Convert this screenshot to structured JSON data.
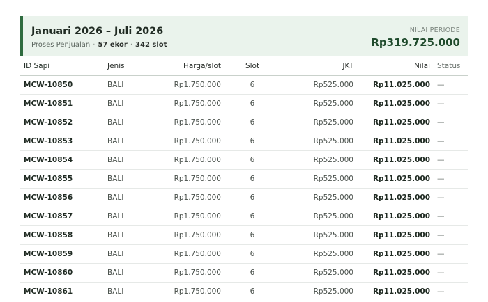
{
  "header": {
    "title": "Januari 2026 – Juli 2026",
    "subtitle_label": "Proses Penjualan",
    "ekor": "57 ekor",
    "slot": "342 slot",
    "separator": "·",
    "value_label": "NILAI PERIODE",
    "value": "Rp319.725.000"
  },
  "table": {
    "columns": {
      "id": "ID Sapi",
      "jenis": "Jenis",
      "harga": "Harga/slot",
      "slot": "Slot",
      "jkt": "JKT",
      "nilai": "Nilai",
      "status": "Status"
    },
    "rows": [
      {
        "id": "MCW-10850",
        "jenis": "BALI",
        "harga": "Rp1.750.000",
        "slot": "6",
        "jkt": "Rp525.000",
        "nilai": "Rp11.025.000",
        "status": "—"
      },
      {
        "id": "MCW-10851",
        "jenis": "BALI",
        "harga": "Rp1.750.000",
        "slot": "6",
        "jkt": "Rp525.000",
        "nilai": "Rp11.025.000",
        "status": "—"
      },
      {
        "id": "MCW-10852",
        "jenis": "BALI",
        "harga": "Rp1.750.000",
        "slot": "6",
        "jkt": "Rp525.000",
        "nilai": "Rp11.025.000",
        "status": "—"
      },
      {
        "id": "MCW-10853",
        "jenis": "BALI",
        "harga": "Rp1.750.000",
        "slot": "6",
        "jkt": "Rp525.000",
        "nilai": "Rp11.025.000",
        "status": "—"
      },
      {
        "id": "MCW-10854",
        "jenis": "BALI",
        "harga": "Rp1.750.000",
        "slot": "6",
        "jkt": "Rp525.000",
        "nilai": "Rp11.025.000",
        "status": "—"
      },
      {
        "id": "MCW-10855",
        "jenis": "BALI",
        "harga": "Rp1.750.000",
        "slot": "6",
        "jkt": "Rp525.000",
        "nilai": "Rp11.025.000",
        "status": "—"
      },
      {
        "id": "MCW-10856",
        "jenis": "BALI",
        "harga": "Rp1.750.000",
        "slot": "6",
        "jkt": "Rp525.000",
        "nilai": "Rp11.025.000",
        "status": "—"
      },
      {
        "id": "MCW-10857",
        "jenis": "BALI",
        "harga": "Rp1.750.000",
        "slot": "6",
        "jkt": "Rp525.000",
        "nilai": "Rp11.025.000",
        "status": "—"
      },
      {
        "id": "MCW-10858",
        "jenis": "BALI",
        "harga": "Rp1.750.000",
        "slot": "6",
        "jkt": "Rp525.000",
        "nilai": "Rp11.025.000",
        "status": "—"
      },
      {
        "id": "MCW-10859",
        "jenis": "BALI",
        "harga": "Rp1.750.000",
        "slot": "6",
        "jkt": "Rp525.000",
        "nilai": "Rp11.025.000",
        "status": "—"
      },
      {
        "id": "MCW-10860",
        "jenis": "BALI",
        "harga": "Rp1.750.000",
        "slot": "6",
        "jkt": "Rp525.000",
        "nilai": "Rp11.025.000",
        "status": "—"
      },
      {
        "id": "MCW-10861",
        "jenis": "BALI",
        "harga": "Rp1.750.000",
        "slot": "6",
        "jkt": "Rp525.000",
        "nilai": "Rp11.025.000",
        "status": "—"
      }
    ]
  },
  "colors": {
    "accent": "#2f6b3f",
    "header_bg": "#eaf3ec",
    "value_text": "#1f4a2c"
  }
}
